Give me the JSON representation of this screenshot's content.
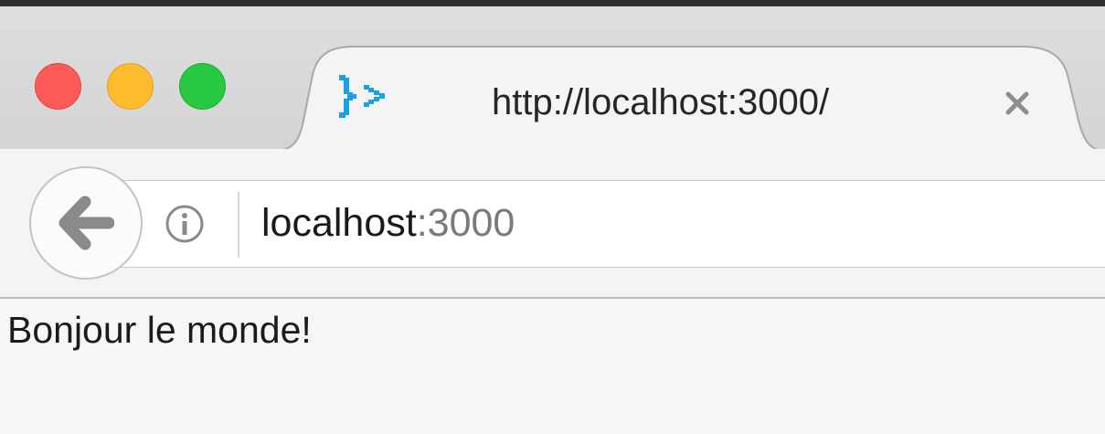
{
  "tab": {
    "title": "http://localhost:3000/",
    "favicon": "node-prompt-icon",
    "favicon_color": "#1ba1e2"
  },
  "address_bar": {
    "host": "localhost",
    "port": ":3000"
  },
  "icons": {
    "back": "back-arrow-icon",
    "info": "info-icon",
    "close_tab": "close-icon"
  },
  "colors": {
    "close": "#fc5b57",
    "minimize": "#fdbc2e",
    "zoom": "#28c840"
  },
  "page": {
    "body_text": "Bonjour le monde!"
  }
}
